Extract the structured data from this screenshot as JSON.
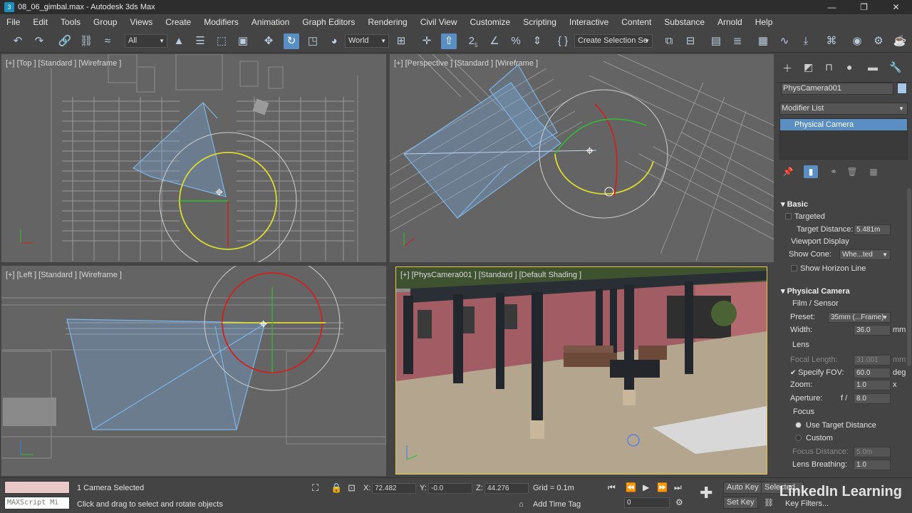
{
  "window": {
    "title": "08_06_gimbal.max - Autodesk 3ds Max",
    "app_icon": "3ds-max-icon"
  },
  "menu": [
    "File",
    "Edit",
    "Tools",
    "Group",
    "Views",
    "Create",
    "Modifiers",
    "Animation",
    "Graph Editors",
    "Rendering",
    "Civil View",
    "Customize",
    "Scripting",
    "Interactive",
    "Content",
    "Substance",
    "Arnold",
    "Help"
  ],
  "toolbar": {
    "filter": "All",
    "ref_coord": "World",
    "selection_set": "Create Selection Se",
    "snap_label": "2",
    "snap_sub": "5"
  },
  "viewports": {
    "top": "[+] [Top ] [Standard ] [Wireframe ]",
    "perspective": "[+] [Perspective ] [Standard ] [Wireframe ]",
    "left": "[+] [Left ] [Standard ] [Wireframe ]",
    "camera": "[+] [PhysCamera001 ] [Standard ] [Default Shading ]"
  },
  "command_panel": {
    "object_name": "PhysCamera001",
    "object_color": "#a7c6e8",
    "modifier_list": "Modifier List",
    "stack_item": "Physical Camera",
    "basic": {
      "header": "Basic",
      "targeted": "Targeted",
      "target_distance_label": "Target Distance:",
      "target_distance": "5.481m",
      "viewport_display": "Viewport Display",
      "show_cone_label": "Show Cone:",
      "show_cone": "Whe...ted",
      "show_horizon": "Show Horizon Line"
    },
    "physical_camera": {
      "header": "Physical Camera",
      "film_sensor": "Film / Sensor",
      "preset_label": "Preset:",
      "preset": "35mm (...Frame)",
      "width_label": "Width:",
      "width": "36.0",
      "width_unit": "mm",
      "lens": "Lens",
      "focal_length_label": "Focal Length:",
      "focal_length": "31.001",
      "focal_unit": "mm",
      "specify_fov_label": "Specify FOV:",
      "fov": "60.0",
      "fov_unit": "deg",
      "zoom_label": "Zoom:",
      "zoom": "1.0",
      "zoom_unit": "x",
      "aperture_label": "Aperture:",
      "aperture_prefix": "f /",
      "aperture": "8.0",
      "focus": "Focus",
      "use_target_distance": "Use Target Distance",
      "custom": "Custom",
      "focus_distance_label": "Focus Distance:",
      "focus_distance": "5.0m",
      "lens_breathing_label": "Lens Breathing:",
      "lens_breathing": "1.0"
    }
  },
  "status": {
    "maxscript": "MAXScript Mi",
    "selection": "1 Camera Selected",
    "prompt": "Click and drag to select and rotate objects",
    "x_label": "X:",
    "x": "72.482",
    "y_label": "Y:",
    "y": "-0.0",
    "z_label": "Z:",
    "z": "44.276",
    "grid": "Grid = 0.1m",
    "add_time_tag": "Add Time Tag",
    "frame": "0",
    "auto_key": "Auto Key",
    "selected": "Selected",
    "set_key": "Set Key",
    "key_filters": "Key Filters..."
  },
  "watermark": "LinkedIn Learning"
}
